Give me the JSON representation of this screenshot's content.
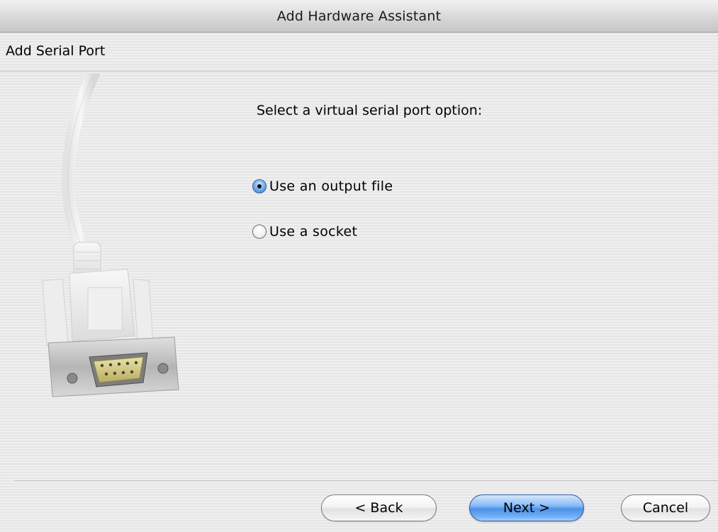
{
  "window": {
    "title": "Add Hardware Assistant"
  },
  "header": {
    "step_title": "Add Serial Port"
  },
  "illustration": {
    "icon": "serial-port-cable-icon"
  },
  "main": {
    "prompt": "Select a virtual serial port option:",
    "options": [
      {
        "label": "Use an output file",
        "selected": true
      },
      {
        "label": "Use a socket",
        "selected": false
      }
    ]
  },
  "footer": {
    "back_label": "< Back",
    "next_label": "Next >",
    "cancel_label": "Cancel"
  },
  "colors": {
    "accent": "#4d92e8",
    "background": "#ececec"
  }
}
